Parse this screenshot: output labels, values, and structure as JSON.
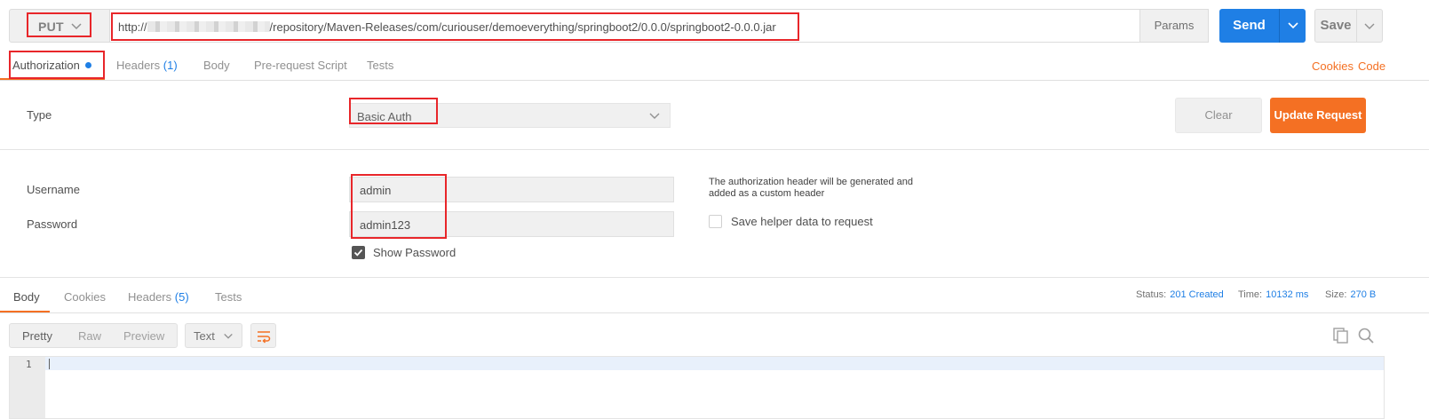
{
  "request": {
    "method": "PUT",
    "url_prefix": "http://",
    "url_path": "/repository/Maven-Releases/com/curiouser/demoeverything/springboot2/0.0.0/springboot2-0.0.0.jar",
    "params_label": "Params",
    "send_label": "Send",
    "save_label": "Save"
  },
  "request_tabs": {
    "authorization": "Authorization",
    "headers": "Headers",
    "headers_count": "(1)",
    "body": "Body",
    "pre_request": "Pre-request Script",
    "tests": "Tests",
    "cookies_link": "Cookies",
    "code_link": "Code"
  },
  "auth": {
    "type_label": "Type",
    "type_value": "Basic Auth",
    "clear_label": "Clear",
    "update_label": "Update Request",
    "username_label": "Username",
    "username_value": "admin",
    "password_label": "Password",
    "password_value": "admin123",
    "show_password_label": "Show Password",
    "show_password_checked": true,
    "helper_note": "The authorization header will be generated and added as a custom header",
    "save_helper_label": "Save helper data to request",
    "save_helper_checked": false
  },
  "response": {
    "tabs": {
      "body": "Body",
      "cookies": "Cookies",
      "headers": "Headers",
      "headers_count": "(5)",
      "tests": "Tests"
    },
    "status_label": "Status:",
    "status_value": "201 Created",
    "time_label": "Time:",
    "time_value": "10132 ms",
    "size_label": "Size:",
    "size_value": "270 B",
    "views": {
      "pretty": "Pretty",
      "raw": "Raw",
      "preview": "Preview"
    },
    "format": "Text",
    "line_number": "1"
  },
  "colors": {
    "accent_blue": "#1f7fe5",
    "accent_orange": "#f47023",
    "highlight_red": "#e8262a"
  }
}
